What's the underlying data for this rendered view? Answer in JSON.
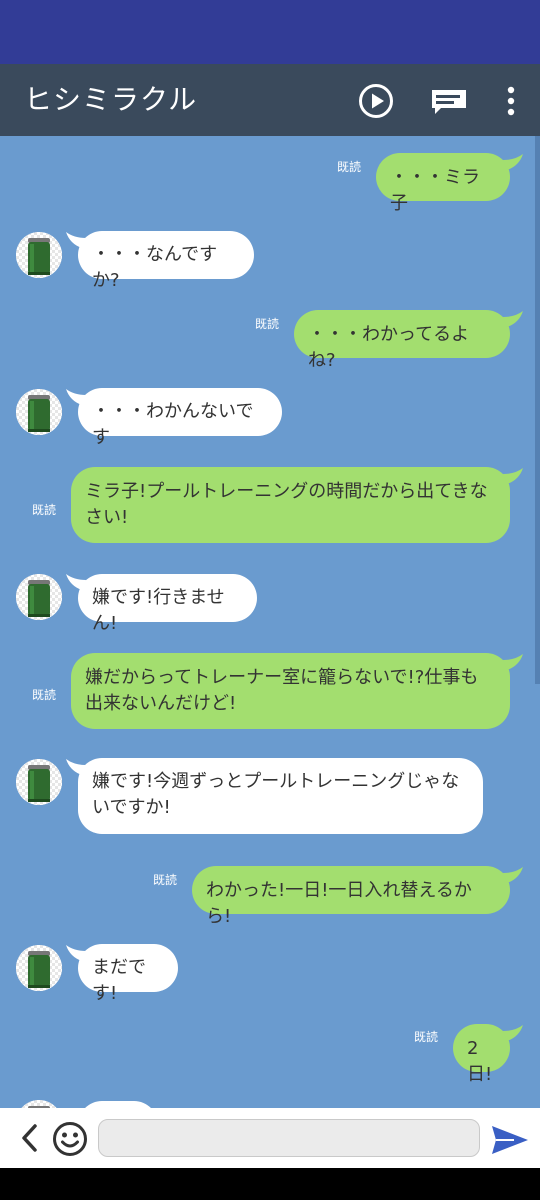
{
  "app": {
    "title": "ヒシミラクル"
  },
  "icons": {
    "play": "play-circle-icon",
    "chat": "chat-bubble-icon",
    "more": "more-vert-icon",
    "back": "chevron-left-icon",
    "emoji": "smiley-icon",
    "send": "send-icon"
  },
  "read_label": "既読",
  "messages": [
    {
      "side": "me",
      "text": "・・・ミラ子",
      "read": "既読"
    },
    {
      "side": "them",
      "text": "・・・なんですか?"
    },
    {
      "side": "me",
      "text": "・・・わかってるよね?",
      "read": "既読"
    },
    {
      "side": "them",
      "text": "・・・わかんないです"
    },
    {
      "side": "me",
      "text": "ミラ子!プールトレーニングの時間だから出てきなさい!",
      "read": "既読"
    },
    {
      "side": "them",
      "text": "嫌です!行きません!"
    },
    {
      "side": "me",
      "text": "嫌だからってトレーナー室に籠らないで!?仕事も出来ないんだけど!",
      "read": "既読"
    },
    {
      "side": "them",
      "text": "嫌です!今週ずっとプールトレーニングじゃないですか!"
    },
    {
      "side": "me",
      "text": "わかった!一日!一日入れ替えるから!",
      "read": "既読"
    },
    {
      "side": "them",
      "text": "まだです!"
    },
    {
      "side": "me",
      "text": "2日!",
      "read": "既読"
    }
  ],
  "input": {
    "value": "",
    "placeholder": ""
  },
  "colors": {
    "status_bar": "#323c96",
    "app_bar": "#3a4a5c",
    "chat_bg": "#6a9bcf",
    "my_bubble": "#a3de6f",
    "their_bubble": "#ffffff",
    "send_icon": "#3a5fc4"
  }
}
